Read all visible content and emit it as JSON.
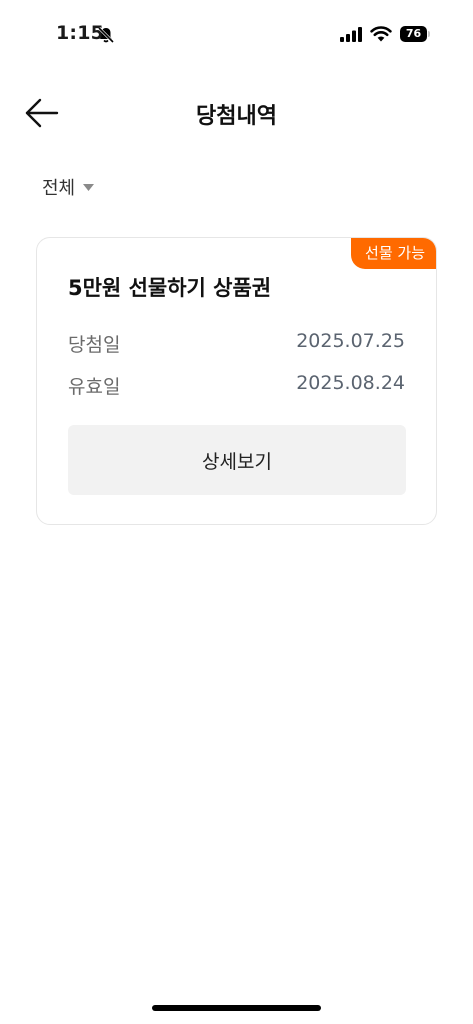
{
  "status_bar": {
    "time": "1:15",
    "battery_level": "76",
    "icons": [
      "bell-off-icon",
      "signal-icon",
      "wifi-icon",
      "battery-icon"
    ]
  },
  "header": {
    "title": "당첨내역",
    "back_icon": "arrow-left-icon"
  },
  "filter": {
    "selected": "전체",
    "icon": "caret-down-icon"
  },
  "prizes": [
    {
      "badge": "선물 가능",
      "name": "5만원 선물하기 상품권",
      "win_date_label": "당첨일",
      "win_date": "2025.07.25",
      "expire_date_label": "유효일",
      "expire_date": "2025.08.24",
      "detail_button": "상세보기"
    }
  ],
  "colors": {
    "accent": "#ff6a00",
    "button_bg": "#f2f2f2",
    "card_border": "#e6e6e6"
  }
}
